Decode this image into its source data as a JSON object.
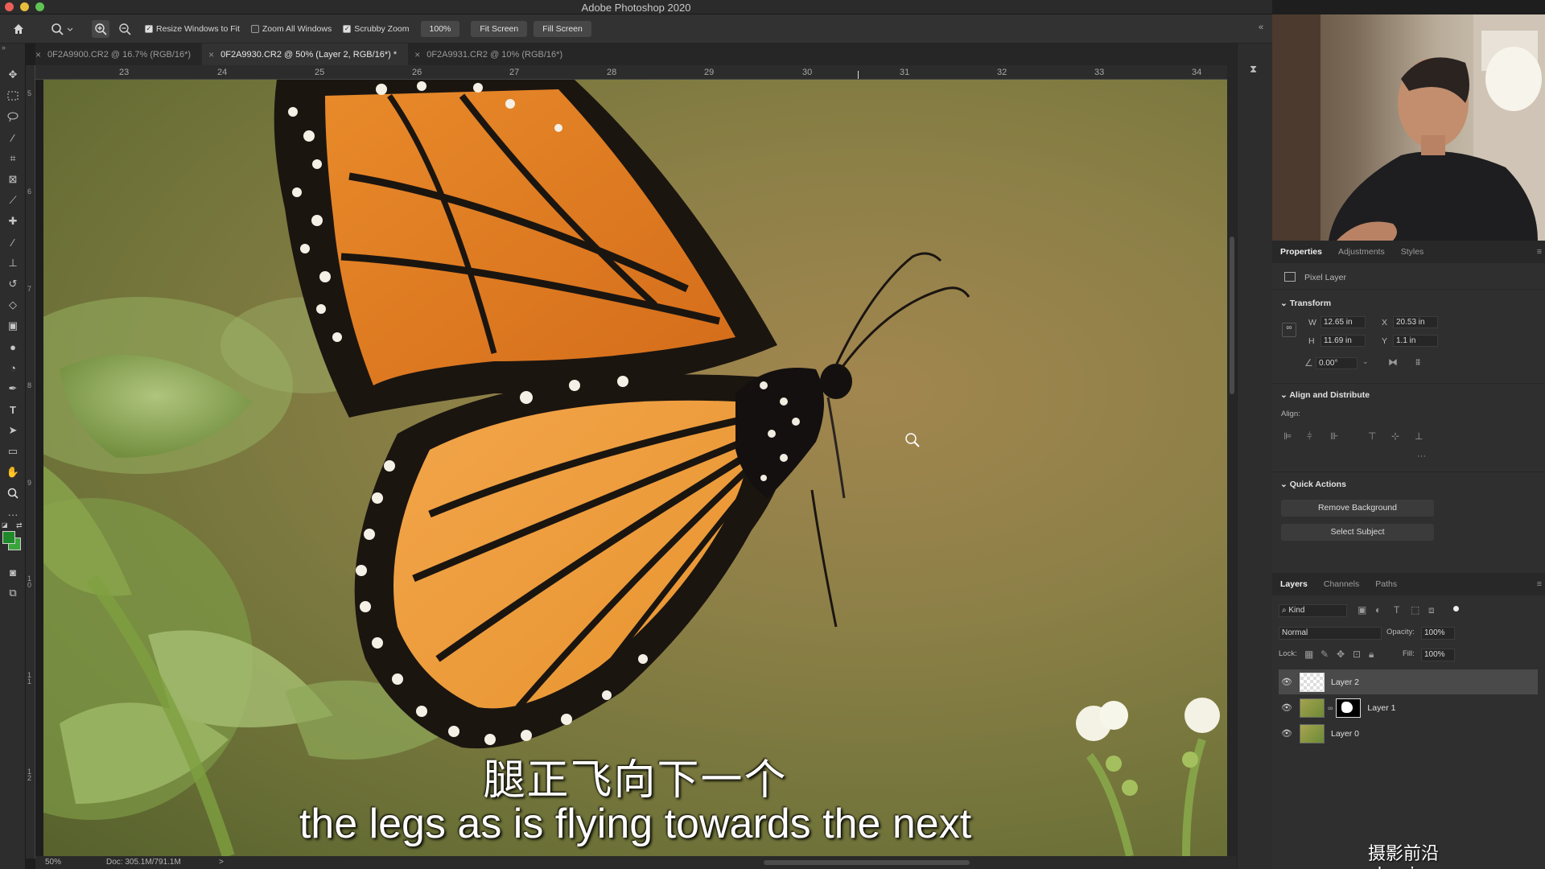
{
  "app": {
    "title": "Adobe Photoshop 2020"
  },
  "options_bar": {
    "resize_windows": "Resize Windows to Fit",
    "zoom_all": "Zoom All Windows",
    "scrubby_zoom": "Scrubby Zoom",
    "zoom_value": "100%",
    "fit_screen": "Fit Screen",
    "fill_screen": "Fill Screen"
  },
  "tabs": [
    {
      "label": "0F2A9900.CR2 @ 16.7% (RGB/16*)"
    },
    {
      "label": "0F2A9930.CR2 @ 50% (Layer 2, RGB/16*) *"
    },
    {
      "label": "0F2A9931.CR2 @ 10% (RGB/16*)"
    }
  ],
  "ruler": {
    "h_ticks": [
      "23",
      "24",
      "25",
      "26",
      "27",
      "28",
      "29",
      "30",
      "31",
      "32",
      "33",
      "34"
    ],
    "v_ticks": [
      "5",
      "6",
      "7",
      "8",
      "9",
      "1 0",
      "1 1",
      "1 2"
    ]
  },
  "canvas": {
    "subtitle_cn": "腿正飞向下一个",
    "subtitle_en": "the legs as is flying towards the next"
  },
  "status": {
    "zoom": "50%",
    "doc": "Doc: 305.1M/791.1M",
    "arrow": ">"
  },
  "properties": {
    "tabs": [
      "Properties",
      "Adjustments",
      "Styles"
    ],
    "layer_type": "Pixel Layer",
    "transform_title": "Transform",
    "w_label": "W",
    "w_value": "12.65 in",
    "h_label": "H",
    "h_value": "11.69 in",
    "x_label": "X",
    "x_value": "20.53 in",
    "y_label": "Y",
    "y_value": "1.1 in",
    "angle_value": "0.00°",
    "align_title": "Align and Distribute",
    "align_label": "Align:",
    "quick_title": "Quick Actions",
    "remove_bg": "Remove Background",
    "select_subject": "Select Subject"
  },
  "layers_panel": {
    "tabs": [
      "Layers",
      "Channels",
      "Paths"
    ],
    "kind": "Kind",
    "blend_mode": "Normal",
    "opacity_label": "Opacity:",
    "opacity_value": "100%",
    "lock_label": "Lock:",
    "fill_label": "Fill:",
    "fill_value": "100%",
    "layers": [
      {
        "name": "Layer 2"
      },
      {
        "name": "Layer 1"
      },
      {
        "name": "Layer 0"
      }
    ]
  },
  "watermark": "摄影前沿 sheyingzyz.com",
  "colors": {
    "foreground": "#1f8a2a",
    "background": "#3aa53a",
    "accent": "#f0f0f0"
  }
}
